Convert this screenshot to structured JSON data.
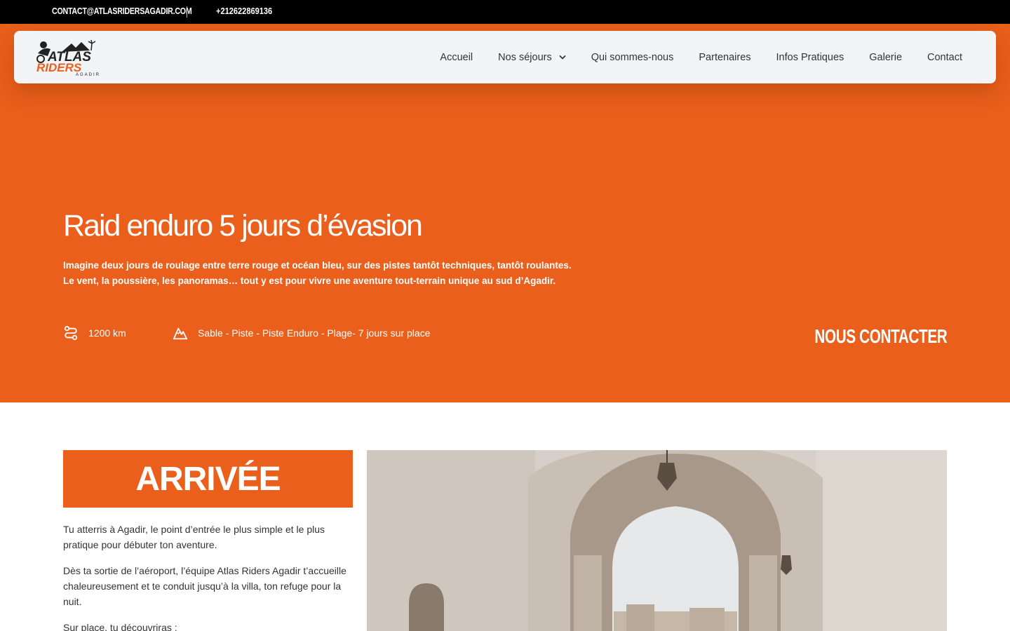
{
  "topbar": {
    "email": "CONTACT@ATLASRIDERSAGADIR.COM",
    "phone": "+212622869136"
  },
  "logo": {
    "line1": "ATLAS",
    "line2": "RIDERS",
    "line3": "AGADIR"
  },
  "nav": {
    "items": [
      {
        "label": "Accueil"
      },
      {
        "label": "Nos séjours"
      },
      {
        "label": "Qui sommes-nous"
      },
      {
        "label": "Partenaires"
      },
      {
        "label": "Infos Pratiques"
      },
      {
        "label": "Galerie"
      },
      {
        "label": "Contact"
      }
    ]
  },
  "hero": {
    "title": "Raid enduro 5 jours d’évasion",
    "desc_line1": "Imagine deux jours de roulage entre terre rouge et océan bleu, sur des pistes tantôt techniques, tantôt roulantes.",
    "desc_line2": "Le vent, la poussière, les panoramas… tout y est pour vivre une aventure tout-terrain unique au sud d’Agadir.",
    "distance": "1200 km",
    "terrain": "Sable - Piste - Piste Enduro - Plage- 7 jours sur place",
    "cta": "NOUS CONTACTER"
  },
  "arrival": {
    "heading": "ARRIVÉE",
    "p1": "Tu atterris à Agadir, le point d’entrée le plus simple et le plus pratique pour débuter ton aventure.",
    "p2": "Dès ta sortie de l’aéroport, l’équipe Atlas Riders Agadir t’accueille chaleureusement et te conduit jusqu’à la villa, ton refuge pour la nuit.",
    "p3": "Sur place, tu découvriras :"
  },
  "colors": {
    "accent": "#e95f1b",
    "topbar": "#000000",
    "header_bg": "#f3f4f6"
  },
  "icons": {
    "route": "route-icon",
    "mountain": "mountain-icon",
    "chevron": "chevron-down-icon"
  }
}
